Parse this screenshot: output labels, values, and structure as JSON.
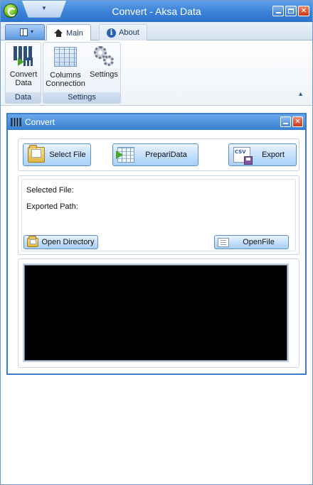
{
  "window": {
    "title_doc": "Convert",
    "title_sep": " - ",
    "title_app": "Aksa Data"
  },
  "ribbon": {
    "tabs": [
      {
        "label": "Main",
        "icon": "home-icon",
        "active": true
      },
      {
        "label": "About",
        "icon": "info-icon",
        "active": false
      }
    ],
    "groups": [
      {
        "label": "Data",
        "buttons": [
          {
            "label_line1": "Convert",
            "label_line2": "Data",
            "icon": "convert-data-icon"
          }
        ]
      },
      {
        "label": "Settings",
        "buttons": [
          {
            "label_line1": "Columns",
            "label_line2": "Connection",
            "icon": "columns-icon"
          },
          {
            "label_line1": "Settings",
            "label_line2": "",
            "icon": "settings-icon"
          }
        ]
      }
    ]
  },
  "child_window": {
    "title": "Convert",
    "actions": {
      "select_file": "Select File",
      "prepare_data": "PrepariData",
      "export": "Export"
    },
    "info": {
      "selected_file_label": "Selected File:",
      "selected_file_value": "",
      "exported_path_label": "Exported Path:",
      "exported_path_value": ""
    },
    "open_directory": "Open Directory",
    "open_file": "OpenFile",
    "console_color": "#000000"
  }
}
